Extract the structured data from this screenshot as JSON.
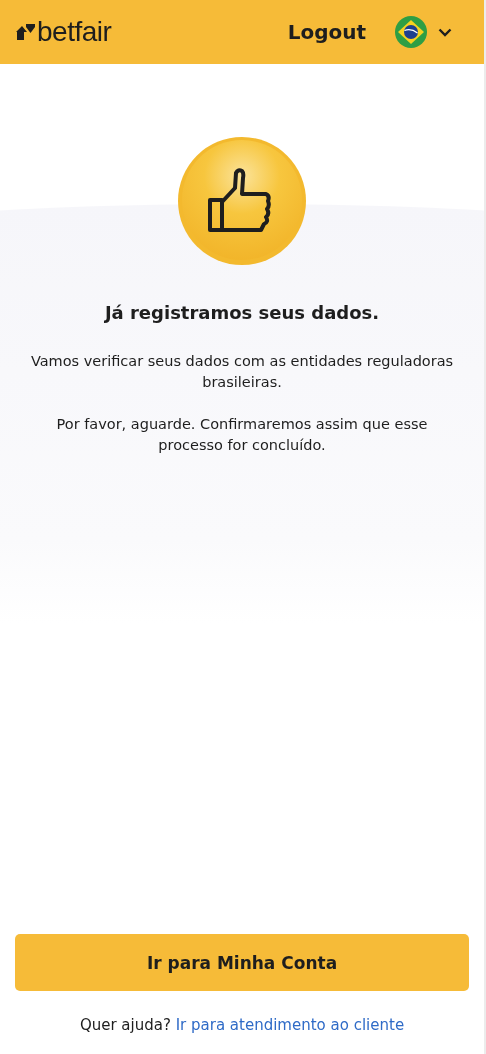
{
  "header": {
    "logo": "betfair",
    "logout": "Logout"
  },
  "title": "Já registramos seus dados.",
  "paragraphs": [
    "Vamos verificar seus dados com as entidades reguladoras brasileiras.",
    "Por favor, aguarde. Confirmaremos assim que esse processo for concluído."
  ],
  "primary_button": "Ir para Minha Conta",
  "help": {
    "text": "Quer ajuda?",
    "link": "Ir para atendimento ao cliente"
  }
}
